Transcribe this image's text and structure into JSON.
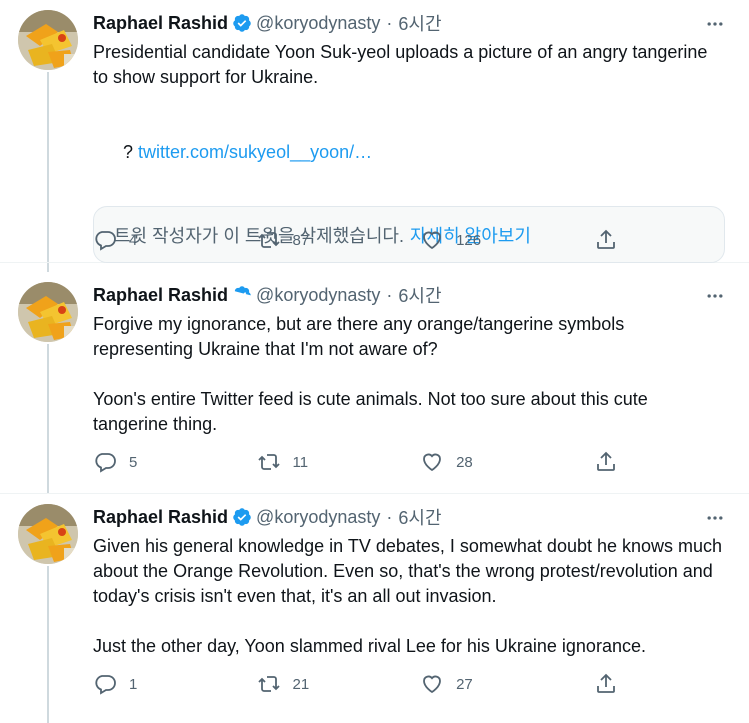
{
  "colors": {
    "accent": "#1d9bf0",
    "muted": "#536471",
    "text": "#0f1419",
    "thread_line": "#cfd9de"
  },
  "tweets": [
    {
      "author_name": "Raphael Rashid",
      "handle": "@koryodynasty",
      "dot": "·",
      "time": "6시간",
      "text": "Presidential candidate Yoon Suk-yeol uploads a picture of an angry tangerine to show support for Ukraine.",
      "link_prefix": "? ",
      "link": "twitter.com/sukyeol__yoon/…",
      "deleted_notice": "트윗 작성자가 이 트윗을 삭제했습니다.",
      "learn_more": "자세히 알아보기",
      "replies": "4",
      "retweets": "87",
      "likes": "126"
    },
    {
      "author_name": "Raphael Rashid",
      "handle": "@koryodynasty",
      "dot": "·",
      "time": "6시간",
      "text": "Forgive my ignorance, but are there any orange/tangerine symbols representing Ukraine that I'm not aware of?\n\nYoon's entire Twitter feed is cute animals. Not too sure about this cute tangerine thing.",
      "replies": "5",
      "retweets": "11",
      "likes": "28"
    },
    {
      "author_name": "Raphael Rashid",
      "handle": "@koryodynasty",
      "dot": "·",
      "time": "6시간",
      "text": "Given his general knowledge in TV debates, I somewhat doubt he knows much about the Orange Revolution. Even so, that's the wrong protest/revolution and today's crisis isn't even that, it's an all out invasion.\n\nJust the other day, Yoon slammed rival Lee for his Ukraine ignorance.",
      "replies": "1",
      "retweets": "21",
      "likes": "27"
    }
  ],
  "icons": {
    "verified": "verified-badge-icon",
    "more": "more-options-icon",
    "reply": "reply-icon",
    "retweet": "retweet-icon",
    "like": "like-icon",
    "share": "share-icon"
  }
}
